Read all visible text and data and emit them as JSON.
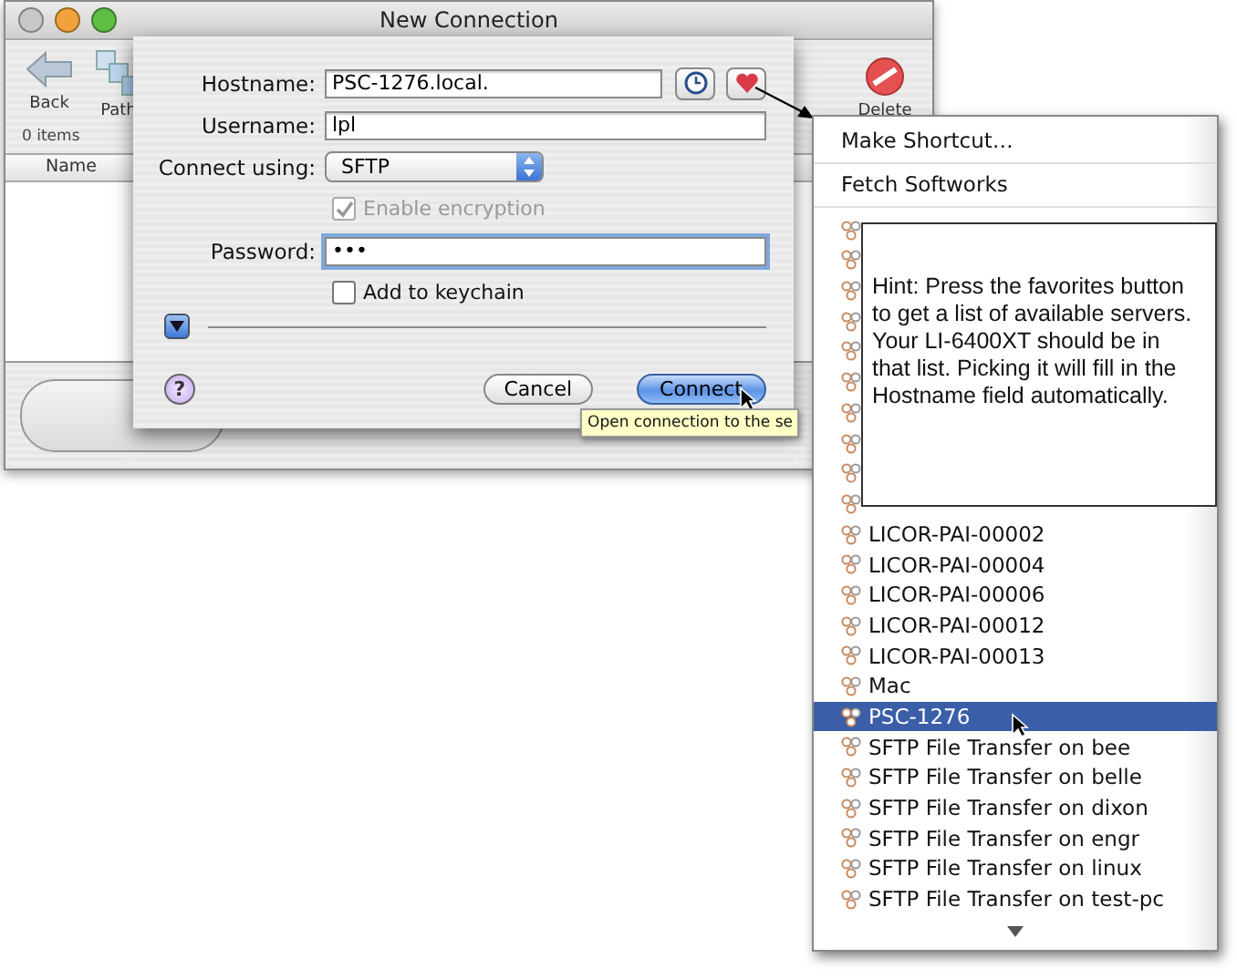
{
  "window": {
    "title": "New Connection"
  },
  "toolbar": [
    {
      "label": "Back",
      "kind": "back"
    },
    {
      "label": "Path",
      "kind": "path"
    },
    {
      "label": "Delete",
      "kind": "delete"
    }
  ],
  "status": "0 items",
  "columns": [
    "Name"
  ],
  "sheet": {
    "fields": [
      {
        "kind": "host",
        "label": "Hostname:",
        "value": "PSC-1276.local.",
        "focused": false
      },
      {
        "kind": "text",
        "label": "Username:",
        "value": "lpl",
        "focused": false
      },
      {
        "kind": "select",
        "label": "Connect using:",
        "value": "SFTP"
      },
      {
        "kind": "checkbox",
        "text": "Enable encryption",
        "checked": true,
        "disabled": true
      },
      {
        "kind": "text",
        "label": "Password:",
        "value": "•••",
        "focused": true
      },
      {
        "kind": "checkbox",
        "text": "Add to keychain",
        "checked": false,
        "disabled": false
      }
    ],
    "help": "?",
    "buttons": [
      {
        "label": "Cancel",
        "default": false
      },
      {
        "label": "Connect",
        "default": true
      }
    ],
    "tooltip": "Open connection to the se"
  },
  "menu": {
    "items": [
      "Make Shortcut…",
      "Fetch Softworks"
    ],
    "list": [
      {
        "kind": "covered",
        "selected": false
      },
      {
        "kind": "covered",
        "selected": false
      },
      {
        "kind": "covered",
        "selected": false
      },
      {
        "kind": "covered",
        "selected": false
      },
      {
        "kind": "covered",
        "selected": false
      },
      {
        "kind": "covered",
        "selected": false
      },
      {
        "kind": "covered",
        "selected": false
      },
      {
        "kind": "covered",
        "selected": false
      },
      {
        "kind": "covered",
        "selected": false
      },
      {
        "kind": "covered",
        "selected": false
      },
      {
        "kind": "server",
        "label": "LICOR-PAI-00002",
        "selected": false
      },
      {
        "kind": "server",
        "label": "LICOR-PAI-00004",
        "selected": false
      },
      {
        "kind": "server",
        "label": "LICOR-PAI-00006",
        "selected": false
      },
      {
        "kind": "server",
        "label": "LICOR-PAI-00012",
        "selected": false
      },
      {
        "kind": "server",
        "label": "LICOR-PAI-00013",
        "selected": false
      },
      {
        "kind": "server",
        "label": "Mac",
        "selected": false
      },
      {
        "kind": "server",
        "label": "PSC-1276",
        "selected": true
      },
      {
        "kind": "server",
        "label": "SFTP File Transfer on bee",
        "selected": false
      },
      {
        "kind": "server",
        "label": "SFTP File Transfer on belle",
        "selected": false
      },
      {
        "kind": "server",
        "label": "SFTP File Transfer on dixon",
        "selected": false
      },
      {
        "kind": "server",
        "label": "SFTP File Transfer on engr",
        "selected": false
      },
      {
        "kind": "server",
        "label": "SFTP File Transfer on linux",
        "selected": false
      },
      {
        "kind": "server",
        "label": "SFTP File Transfer on test-pc",
        "selected": false
      }
    ]
  },
  "hint": "Hint: Press the favorites button to get a list of available servers. Your LI-6400XT should be in that list. Picking it will fill in the Hostname field automatically."
}
